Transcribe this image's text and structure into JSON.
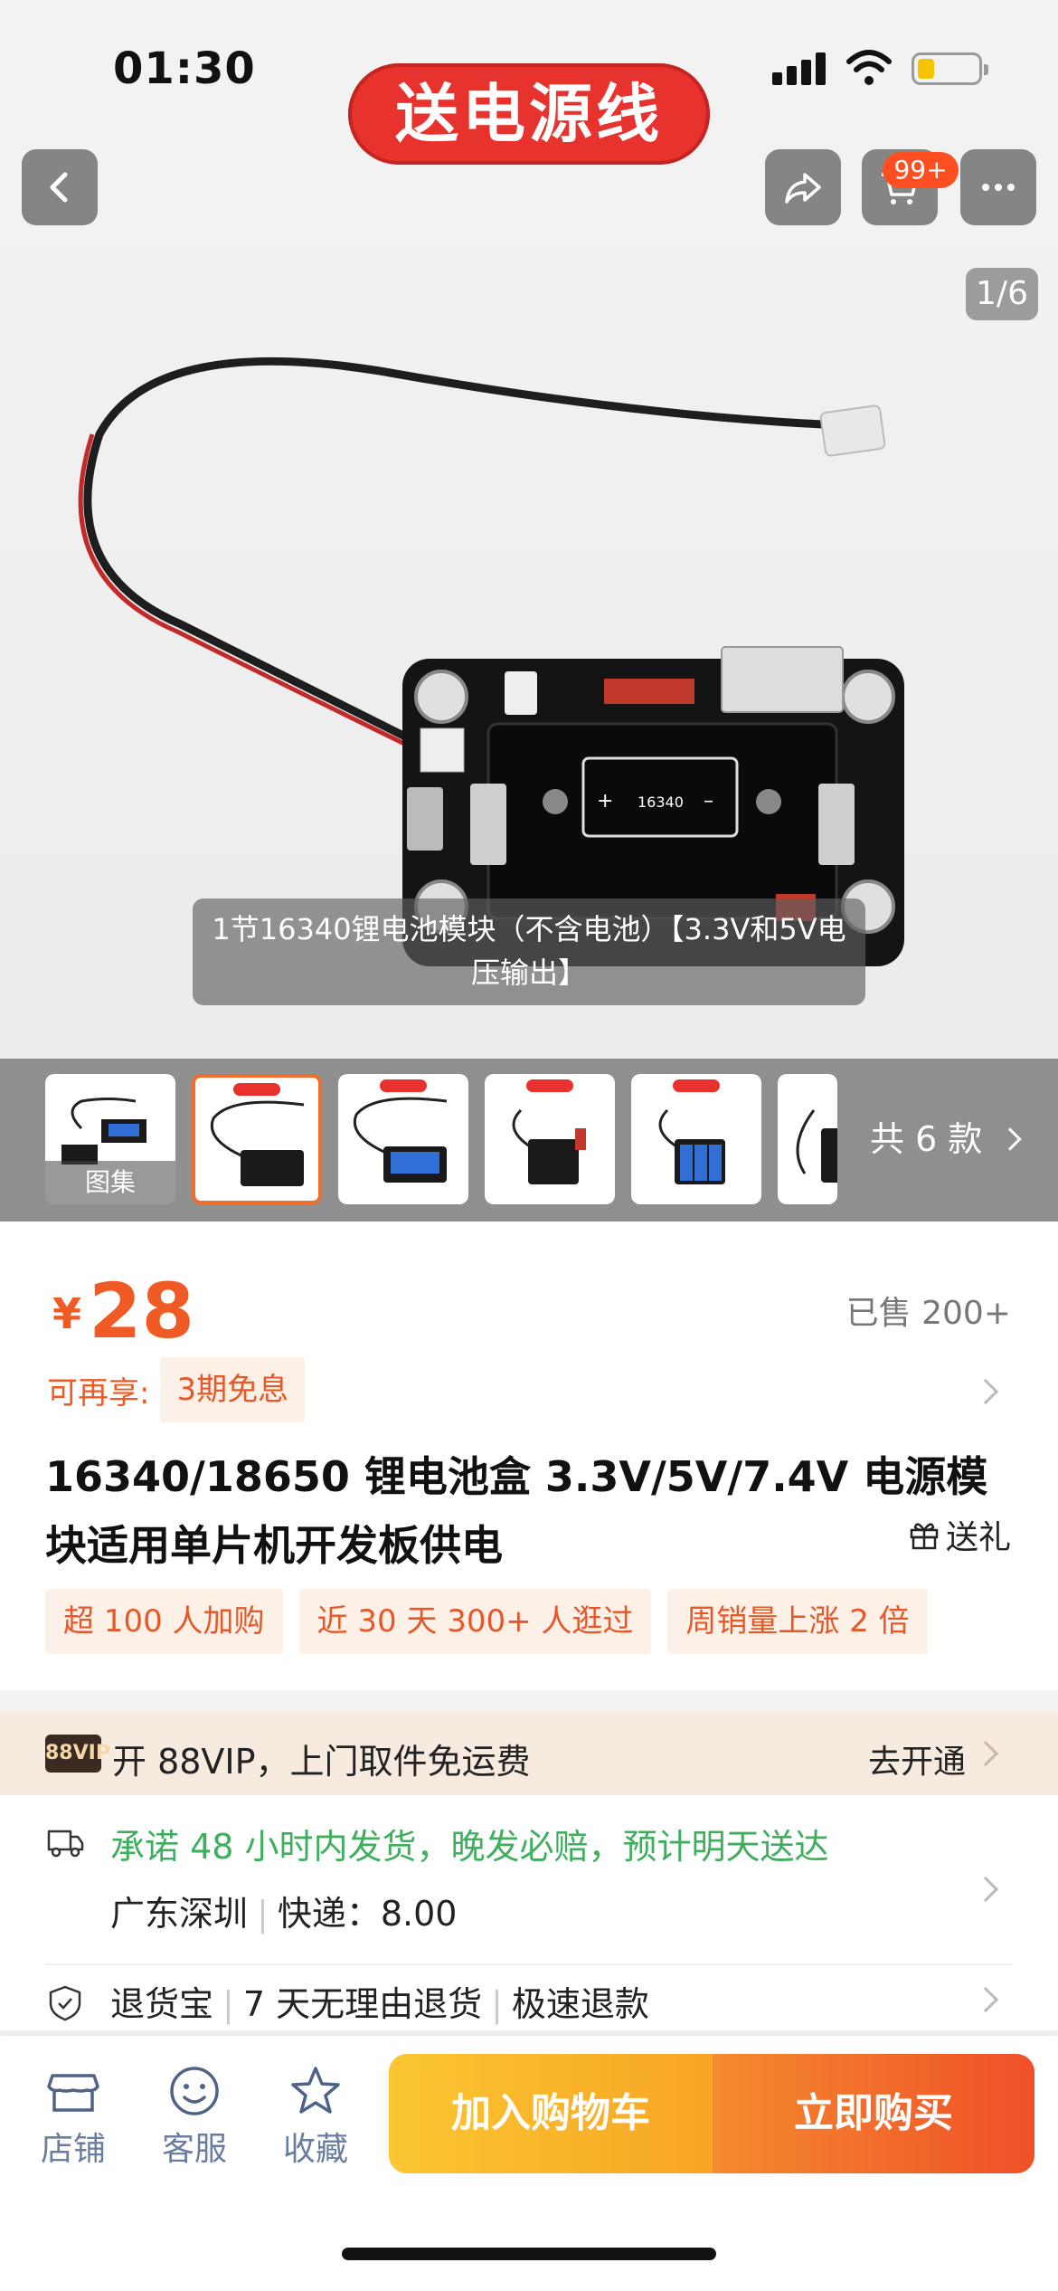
{
  "status": {
    "time": "01:30"
  },
  "brand": {
    "logo_text": "送电源线"
  },
  "header": {
    "cart_badge": "99+",
    "image_counter": "1/6"
  },
  "hero": {
    "caption": "1节16340锂电池模块（不含电池）【3.3V和5V电压输出】",
    "battery_label": "16340"
  },
  "thumbnails": {
    "gallery_label": "图集",
    "total_styles": "共 6 款"
  },
  "product": {
    "currency": "¥",
    "price": "28",
    "sold": "已售 200+",
    "enjoy_label": "可再享:",
    "installment": "3期免息",
    "title": "16340/18650 锂电池盒 3.3V/5V/7.4V 电源模块适用单片机开发板供电",
    "gift": "送礼",
    "tags": [
      "超 100 人加购",
      "近 30 天 300+ 人逛过",
      "周销量上涨 2 倍"
    ]
  },
  "vip": {
    "badge": "88VIP",
    "text": "开 88VIP，上门取件免运费",
    "action": "去开通"
  },
  "shipping": {
    "promise": "承诺 48 小时内发货，晚发必赔，预计明天送达",
    "origin": "广东深圳",
    "express": "快递：8.00",
    "services": [
      "退货宝",
      "7 天无理由退货",
      "极速退款"
    ]
  },
  "bottom_bar": {
    "shop": "店铺",
    "service": "客服",
    "favorite": "收藏",
    "add_cart": "加入购物车",
    "buy_now": "立即购买"
  },
  "colors": {
    "accent": "#ef5a25",
    "green": "#3fae5d",
    "brand_red": "#e8322d"
  }
}
